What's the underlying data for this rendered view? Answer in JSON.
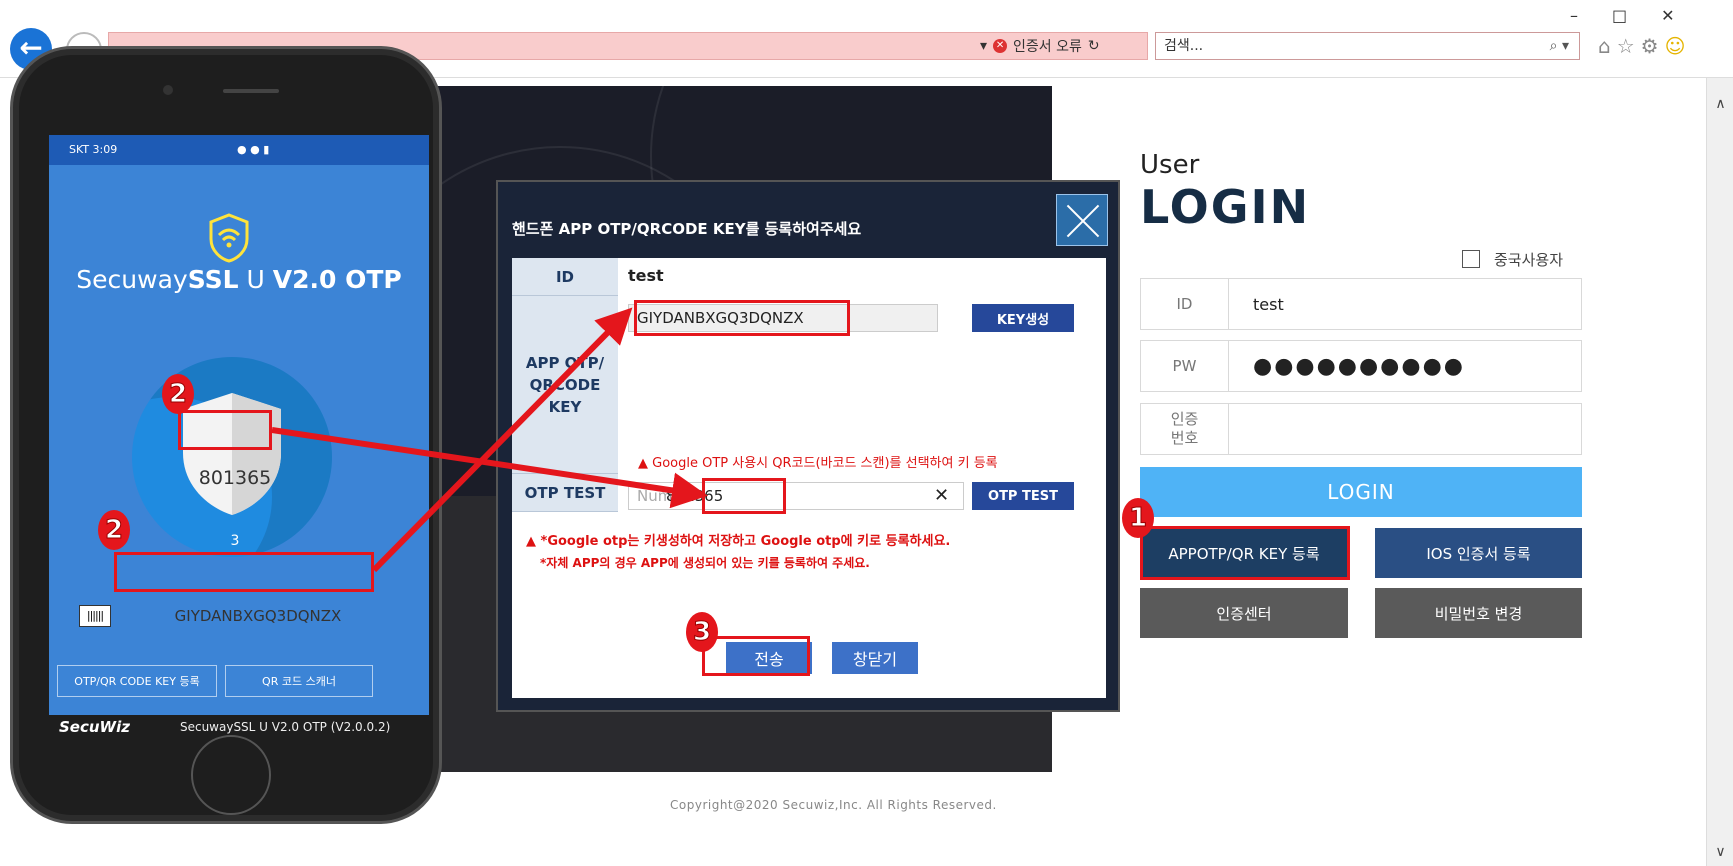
{
  "browser": {
    "cert_error": "인증서 오류",
    "search_placeholder": "검색...",
    "search_icon": "search-icon"
  },
  "page": {
    "copyright": "Copyright@2020 Secuwiz,Inc. All Rights Reserved."
  },
  "login": {
    "user_label": "User",
    "title": "LOGIN",
    "china_user_label": "중국사용자",
    "id_label": "ID",
    "id_value": "test",
    "pw_label": "PW",
    "pw_value": "●●●●●●●●●●",
    "auth_label": "인증\n번호",
    "login_button": "LOGIN",
    "appotp_button": "APPOTP/QR KEY 등록",
    "ios_button": "IOS 인증서 등록",
    "auth_center_button": "인증센터",
    "pw_change_button": "비밀번호 변경"
  },
  "modal": {
    "title": "핸드폰 APP OTP/QRCODE KEY를 등록하여주세요",
    "id_label": "ID",
    "id_value": "test",
    "key_label": "APP OTP/ QRCODE KEY",
    "key_value": "GIYDANBXGQ3DQNZX",
    "key_gen_button": "KEY생성",
    "google_note": "Google OTP 사용시 QR코드(바코드 스캔)를 선택하여 키 등록",
    "otp_test_label": "OTP TEST",
    "otp_placeholder": "Num",
    "otp_value": "801365",
    "otp_test_button": "OTP TEST",
    "note1": "*Google otp는 키생성하여 저장하고 Google otp에 키로 등록하세요.",
    "note2": "*자체 APP의 경우 APP에 생성되어 있는 키를 등록하여 주세요.",
    "send_button": "전송",
    "close_button": "창닫기"
  },
  "phone": {
    "status_left": "SKT 3:09",
    "app_name_light": "Secuway",
    "app_name_bold_a": "SSL",
    "app_name_mid": " U ",
    "app_name_bold_b": "V2.0 OTP",
    "otp_code": "801365",
    "counter": "3",
    "secret_key": "GIYDANBXGQ3DQNZX",
    "register_button": "OTP/QR CODE KEY 등록",
    "qr_scanner_button": "QR 코드 스캐너",
    "footer_logo": "SecuWiz",
    "footer_version": "SecuwaySSL U V2.0 OTP (V2.0.0.2)"
  },
  "annotations": {
    "step1": "1",
    "step2": "2",
    "step3": "3",
    "color": "#e4161c"
  }
}
